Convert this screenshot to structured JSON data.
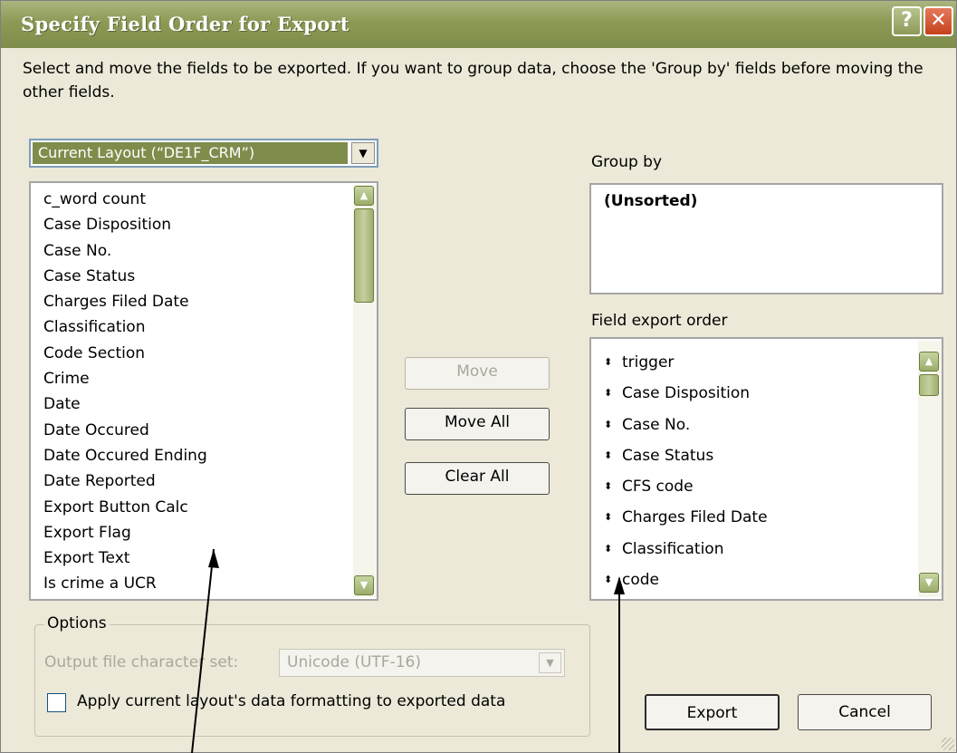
{
  "title": "Specify Field Order for Export",
  "title_buttons": {
    "help": "?",
    "close": "✕"
  },
  "instructions": "Select and move the fields to be exported.  If you want to group data, choose the 'Group by' fields before moving the other fields.",
  "layout_dropdown": {
    "value": "Current Layout (“DE1F_CRM”)",
    "arrow_icon": "▼"
  },
  "available_fields": [
    "c_word count",
    "Case Disposition",
    "Case No.",
    "Case Status",
    "Charges Filed Date",
    "Classification",
    "Code Section",
    "Crime",
    "Date",
    "Date Occured",
    "Date Occured Ending",
    "Date Reported",
    "Export Button Calc",
    "Export Flag",
    "Export Text",
    "Is crime a UCR"
  ],
  "group_by": {
    "label": "Group by",
    "items": [
      "(Unsorted)"
    ]
  },
  "export_order": {
    "label": "Field export order",
    "handle_icon": "⬍",
    "items": [
      "trigger",
      "Case Disposition",
      "Case No.",
      "Case Status",
      "CFS code",
      "Charges Filed Date",
      "Classification",
      "code"
    ]
  },
  "buttons": {
    "move": "Move",
    "move_all": "Move All",
    "clear_all": "Clear All",
    "export": "Export",
    "cancel": "Cancel"
  },
  "options": {
    "legend": "Options",
    "charset_label": "Output file character set:",
    "charset_value": "Unicode (UTF-16)",
    "apply_formatting_label": "Apply current layout's data formatting to exported data",
    "apply_formatting_checked": false
  },
  "scroll_icons": {
    "up": "▲",
    "down": "▼"
  },
  "colors": {
    "title_bar": "#8b9a55",
    "face": "#ece9d8",
    "selected": "#7e8d4b"
  }
}
